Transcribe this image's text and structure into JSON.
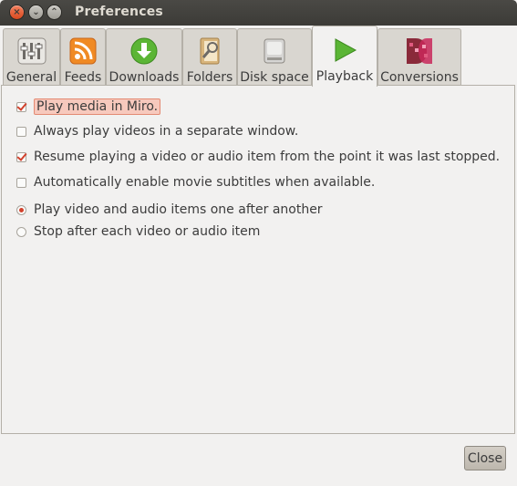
{
  "window": {
    "title": "Preferences"
  },
  "tabs": [
    {
      "label": "General",
      "icon": "sliders-icon"
    },
    {
      "label": "Feeds",
      "icon": "rss-icon"
    },
    {
      "label": "Downloads",
      "icon": "download-icon"
    },
    {
      "label": "Folders",
      "icon": "folder-icon"
    },
    {
      "label": "Disk space",
      "icon": "disk-icon"
    },
    {
      "label": "Playback",
      "icon": "play-icon"
    },
    {
      "label": "Conversions",
      "icon": "conversions-icon"
    }
  ],
  "active_tab": "Playback",
  "options": {
    "play_in_miro": {
      "label": "Play media in Miro.",
      "checked": true
    },
    "separate_window": {
      "label": "Always play videos in a separate window.",
      "checked": false
    },
    "resume_playing": {
      "label": "Resume playing a video or audio item from the point it was last stopped.",
      "checked": true
    },
    "auto_subtitles": {
      "label": "Automatically enable movie subtitles when available.",
      "checked": false
    }
  },
  "play_mode": {
    "one_after_another": {
      "label": "Play video and audio items one after another",
      "selected": true
    },
    "stop_after_each": {
      "label": "Stop after each video or audio item",
      "selected": false
    }
  },
  "footer": {
    "close_label": "Close"
  },
  "colors": {
    "accent": "#d2412c",
    "titlebar": "#3c3b37",
    "background": "#f2f1f0"
  }
}
